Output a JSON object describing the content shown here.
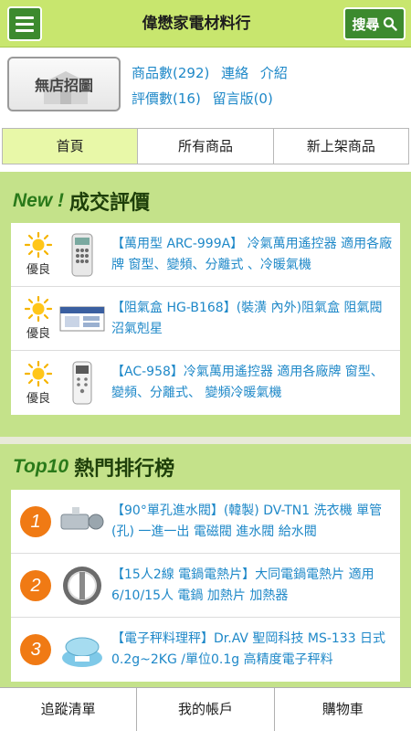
{
  "header": {
    "title": "偉懋家電材料行",
    "search_label": "搜尋"
  },
  "store": {
    "no_sign_text": "無店招圖",
    "product_count": "商品數(292)",
    "contact": "連絡",
    "intro": "介紹",
    "review_count": "評價數(16)",
    "message_board": "留言版(0)"
  },
  "tabs": [
    {
      "label": "首頁",
      "active": true
    },
    {
      "label": "所有商品",
      "active": false
    },
    {
      "label": "新上架商品",
      "active": false
    }
  ],
  "reviews": {
    "title_em": "New !",
    "title": "成交評價",
    "items": [
      {
        "rating": "優良",
        "text": "【萬用型 ARC-999A】 冷氣萬用遙控器 適用各廠牌 窗型、變頻、分離式 、冷暖氣機"
      },
      {
        "rating": "優良",
        "text": "【阻氣盒 HG-B168】(裝潢 內外)阻氣盒 阻氣閥 沼氣剋星"
      },
      {
        "rating": "優良",
        "text": "【AC-958】冷氣萬用遙控器 適用各廠牌 窗型、變頻、分離式、 變頻冷暖氣機"
      }
    ]
  },
  "top10": {
    "title_em": "Top10",
    "title": "熱門排行榜",
    "items": [
      {
        "rank": "1",
        "text": "【90°單孔進水閥】(韓製) DV-TN1 洗衣機 單管(孔) 一進一出 電磁閥 進水閥 給水閥"
      },
      {
        "rank": "2",
        "text": "【15人2線 電鍋電熱片】大同電鍋電熱片 適用6/10/15人 電鍋 加熱片 加熱器"
      },
      {
        "rank": "3",
        "text": "【電子秤料理秤】Dr.AV 聖岡科技 MS-133 日式0.2g~2KG /單位0.1g 高精度電子秤料"
      }
    ]
  },
  "bottom_nav": [
    {
      "label": "追蹤清單"
    },
    {
      "label": "我的帳戶"
    },
    {
      "label": "購物車"
    }
  ],
  "colors": {
    "accent_green": "#3c8a2e",
    "page_bg": "#c4e28a",
    "link_blue": "#1e88c8",
    "rank_orange": "#f07a14"
  }
}
